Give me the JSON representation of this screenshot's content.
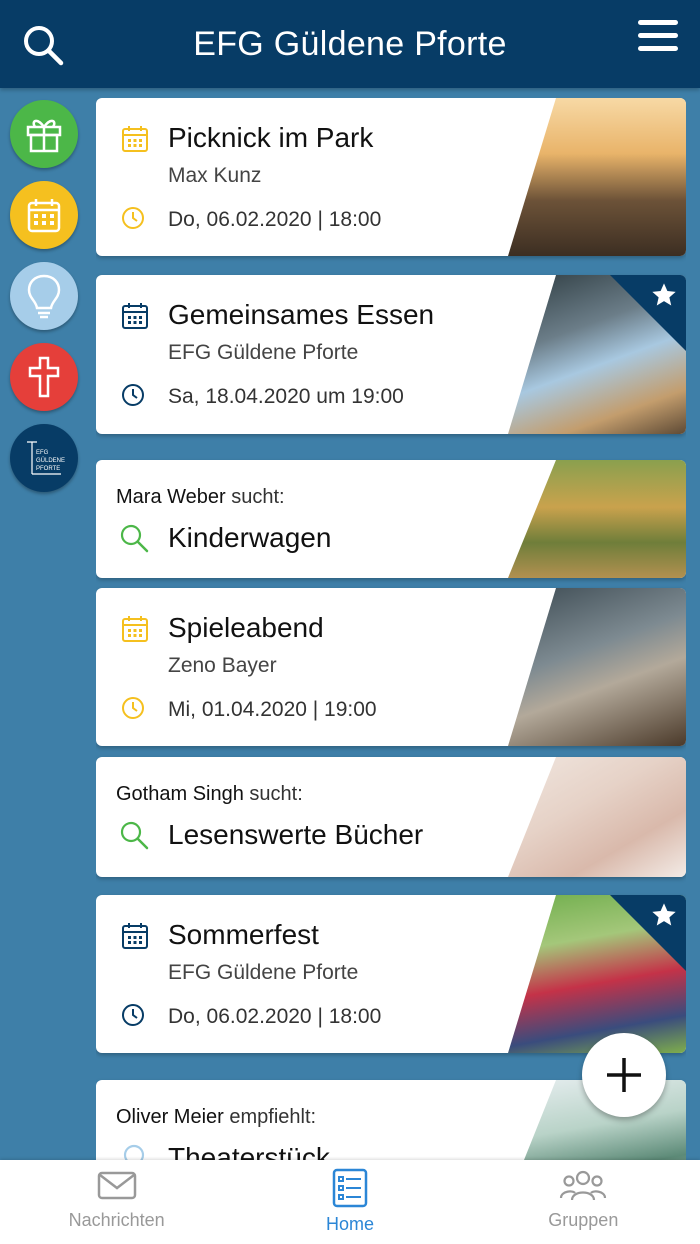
{
  "header": {
    "title": "EFG Güldene Pforte"
  },
  "rail": {
    "logo_text": "EFG GÜLDENE PFORTE"
  },
  "cards": [
    {
      "type": "event",
      "title": "Picknick im Park",
      "subtitle": "Max Kunz",
      "datetime": "Do, 06.02.2020 | 18:00",
      "icon_color": "#f5c01f",
      "starred": false
    },
    {
      "type": "event",
      "title": "Gemeinsames Essen",
      "subtitle": "EFG Güldene Pforte",
      "datetime": "Sa, 18.04.2020 um 19:00",
      "icon_color": "#073c66",
      "starred": true
    },
    {
      "type": "search",
      "person": "Mara Weber",
      "verb": "sucht:",
      "title": "Kinderwagen",
      "icon_color": "#4cb748"
    },
    {
      "type": "event",
      "title": "Spieleabend",
      "subtitle": "Zeno Bayer",
      "datetime": "Mi, 01.04.2020 | 19:00",
      "icon_color": "#f5c01f",
      "starred": false
    },
    {
      "type": "search",
      "person": "Gotham Singh",
      "verb": "sucht:",
      "title": "Lesenswerte Bücher",
      "icon_color": "#4cb748"
    },
    {
      "type": "event",
      "title": "Sommerfest",
      "subtitle": "EFG Güldene Pforte",
      "datetime": "Do, 06.02.2020 | 18:00",
      "icon_color": "#073c66",
      "starred": true
    },
    {
      "type": "recommend",
      "person": "Oliver Meier",
      "verb": "empfiehlt:",
      "title": "Theaterstück",
      "icon_color": "#a6cde9"
    }
  ],
  "bottom_nav": [
    {
      "label": "Nachrichten",
      "icon": "envelope-icon",
      "active": false
    },
    {
      "label": "Home",
      "icon": "list-icon",
      "active": true
    },
    {
      "label": "Gruppen",
      "icon": "group-icon",
      "active": false
    }
  ],
  "colors": {
    "header": "#073c66",
    "background": "#3e7fa8",
    "accent": "#2b86d6"
  }
}
